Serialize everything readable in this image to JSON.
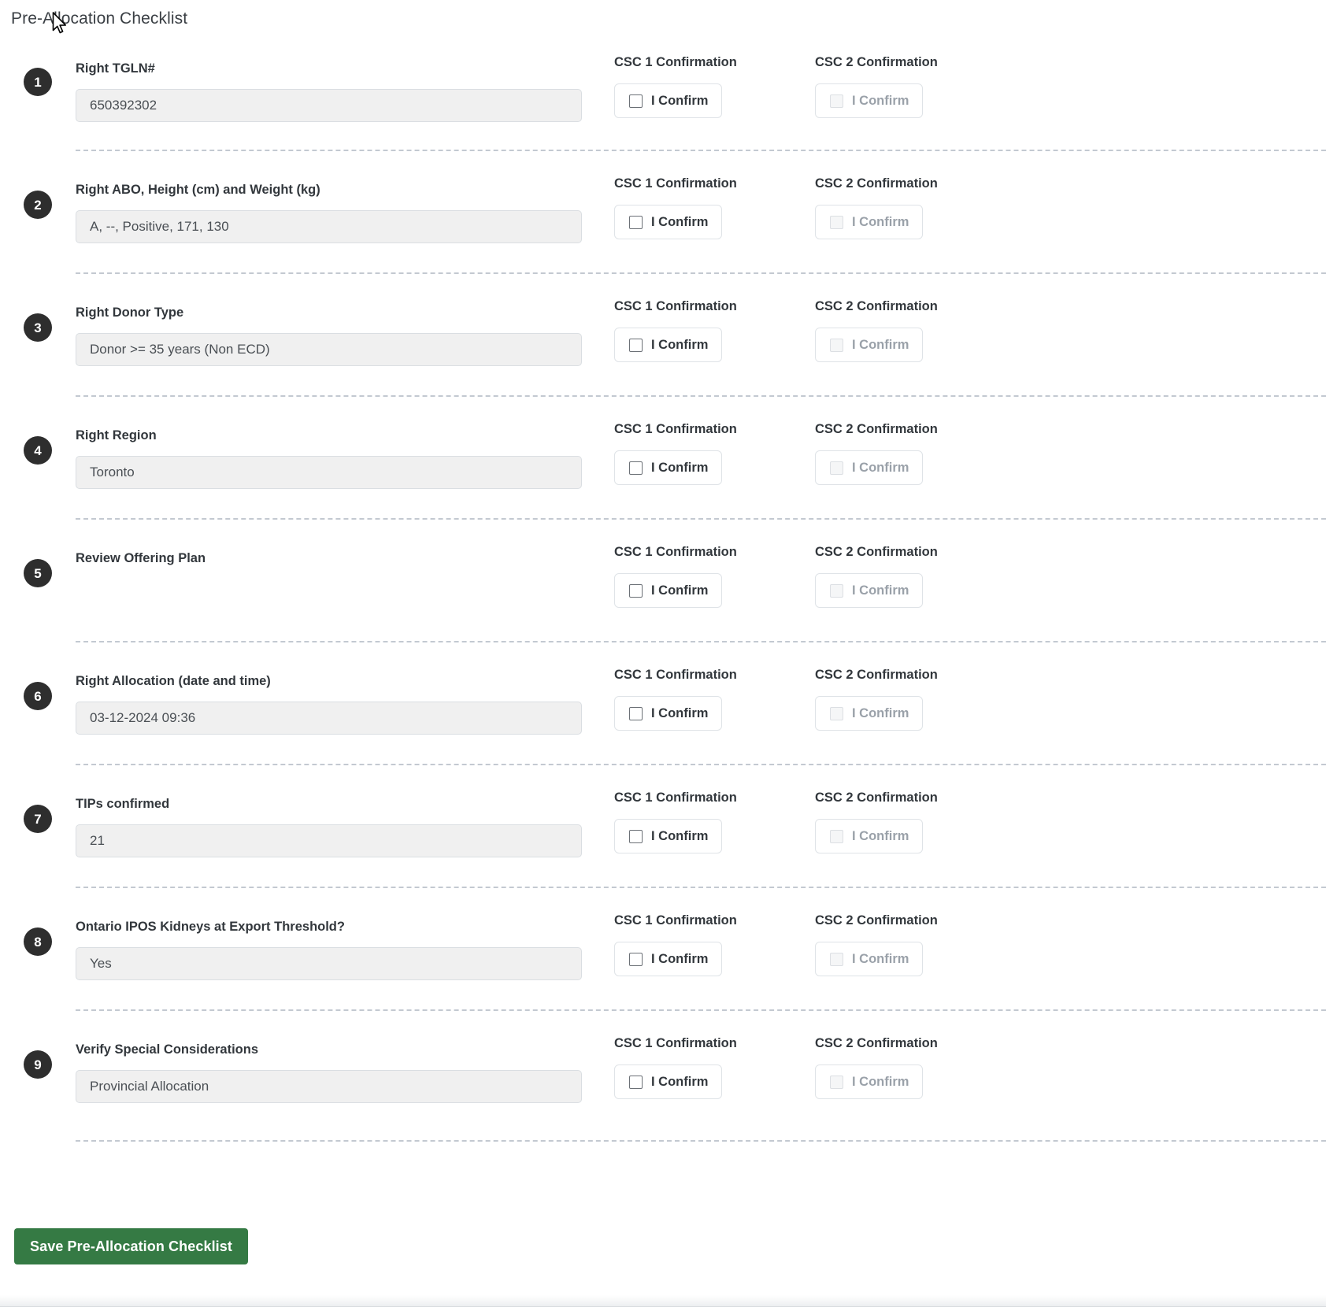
{
  "section": {
    "title": "Pre-Allocation Checklist"
  },
  "columns": {
    "csc1_header": "CSC 1 Confirmation",
    "csc2_header": "CSC 2 Confirmation",
    "confirm_label": "I Confirm"
  },
  "items": [
    {
      "number": "1",
      "label": "Right TGLN#",
      "value": "650392302",
      "has_value_field": true,
      "csc1_header": "CSC 1 Confirmation",
      "csc2_header": "CSC 2 Confirmation",
      "csc1_label": "I Confirm",
      "csc2_label": "I Confirm",
      "csc1_checked": false,
      "csc2_checked": false,
      "csc2_disabled": true
    },
    {
      "number": "2",
      "label": "Right ABO, Height (cm) and Weight (kg)",
      "value": "A, --, Positive, 171, 130",
      "has_value_field": true,
      "csc1_header": "CSC 1 Confirmation",
      "csc2_header": "CSC 2 Confirmation",
      "csc1_label": "I Confirm",
      "csc2_label": "I Confirm",
      "csc1_checked": false,
      "csc2_checked": false,
      "csc2_disabled": true
    },
    {
      "number": "3",
      "label": "Right Donor Type",
      "value": "Donor >= 35 years (Non ECD)",
      "has_value_field": true,
      "csc1_header": "CSC 1 Confirmation",
      "csc2_header": "CSC 2 Confirmation",
      "csc1_label": "I Confirm",
      "csc2_label": "I Confirm",
      "csc1_checked": false,
      "csc2_checked": false,
      "csc2_disabled": true
    },
    {
      "number": "4",
      "label": "Right Region",
      "value": "Toronto",
      "has_value_field": true,
      "csc1_header": "CSC 1 Confirmation",
      "csc2_header": "CSC 2 Confirmation",
      "csc1_label": "I Confirm",
      "csc2_label": "I Confirm",
      "csc1_checked": false,
      "csc2_checked": false,
      "csc2_disabled": true
    },
    {
      "number": "5",
      "label": "Review Offering Plan",
      "value": "",
      "has_value_field": false,
      "csc1_header": "CSC 1 Confirmation",
      "csc2_header": "CSC 2 Confirmation",
      "csc1_label": "I Confirm",
      "csc2_label": "I Confirm",
      "csc1_checked": false,
      "csc2_checked": false,
      "csc2_disabled": true
    },
    {
      "number": "6",
      "label": "Right Allocation (date and time)",
      "value": "03-12-2024 09:36",
      "has_value_field": true,
      "csc1_header": "CSC 1 Confirmation",
      "csc2_header": "CSC 2 Confirmation",
      "csc1_label": "I Confirm",
      "csc2_label": "I Confirm",
      "csc1_checked": false,
      "csc2_checked": false,
      "csc2_disabled": true
    },
    {
      "number": "7",
      "label": "TIPs confirmed",
      "value": "21",
      "has_value_field": true,
      "csc1_header": "CSC 1 Confirmation",
      "csc2_header": "CSC 2 Confirmation",
      "csc1_label": "I Confirm",
      "csc2_label": "I Confirm",
      "csc1_checked": false,
      "csc2_checked": false,
      "csc2_disabled": true
    },
    {
      "number": "8",
      "label": "Ontario IPOS Kidneys at Export Threshold?",
      "value": "Yes",
      "has_value_field": true,
      "csc1_header": "CSC 1 Confirmation",
      "csc2_header": "CSC 2 Confirmation",
      "csc1_label": "I Confirm",
      "csc2_label": "I Confirm",
      "csc1_checked": false,
      "csc2_checked": false,
      "csc2_disabled": true
    },
    {
      "number": "9",
      "label": "Verify Special Considerations",
      "value": "Provincial Allocation",
      "has_value_field": true,
      "csc1_header": "CSC 1 Confirmation",
      "csc2_header": "CSC 2 Confirmation",
      "csc1_label": "I Confirm",
      "csc2_label": "I Confirm",
      "csc1_checked": false,
      "csc2_checked": false,
      "csc2_disabled": true
    }
  ],
  "footer": {
    "save_label": "Save Pre-Allocation Checklist"
  },
  "colors": {
    "save_button_green": "#357a44",
    "badge_dark": "#2e2e2e",
    "field_background": "#f0f0f0",
    "divider_dashed": "#c3c9d1",
    "disabled_text": "#9aa1a9"
  }
}
